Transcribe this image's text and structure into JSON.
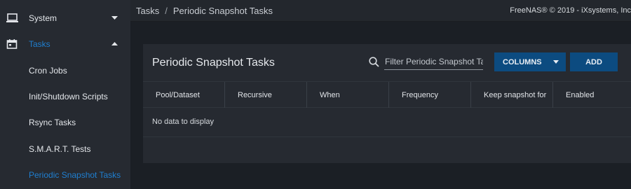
{
  "sidebar": {
    "items": [
      {
        "label": "System",
        "icon": "laptop-icon",
        "caret": "down"
      },
      {
        "label": "Tasks",
        "icon": "calendar-icon",
        "caret": "up",
        "active": true
      },
      {
        "label": "Cron Jobs"
      },
      {
        "label": "Init/Shutdown Scripts"
      },
      {
        "label": "Rsync Tasks"
      },
      {
        "label": "S.M.A.R.T. Tests"
      },
      {
        "label": "Periodic Snapshot Tasks",
        "active": true
      }
    ]
  },
  "header": {
    "breadcrumb": [
      "Tasks",
      "Periodic Snapshot Tasks"
    ],
    "separator": "/",
    "copyright": "FreeNAS® © 2019 - iXsystems, Inc"
  },
  "card": {
    "title": "Periodic Snapshot Tasks",
    "filter_placeholder": "Filter Periodic Snapshot Tasks",
    "columns_label": "COLUMNS",
    "add_label": "ADD",
    "table": {
      "columns": [
        "Pool/Dataset",
        "Recursive",
        "When",
        "Frequency",
        "Keep snapshot for",
        "Enabled"
      ],
      "rows": [],
      "empty_message": "No data to display"
    }
  },
  "colors": {
    "accent": "#1f7fd0",
    "button": "#0c4b80",
    "sidebar_bg": "#262a31",
    "page_bg": "#1b1f25"
  }
}
